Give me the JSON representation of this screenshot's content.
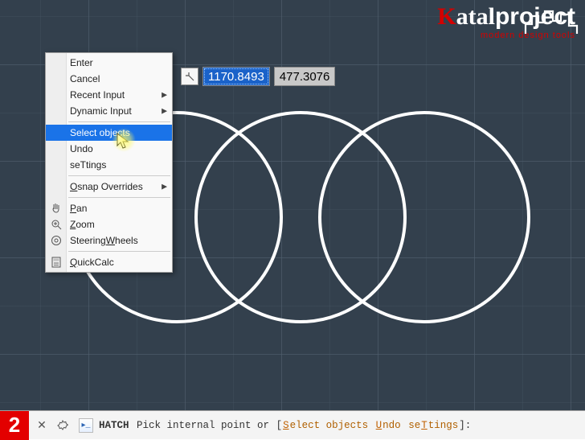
{
  "logo": {
    "text_head": "Katal",
    "text_tail": "project",
    "tagline": "modern design tools"
  },
  "coord": {
    "x": "1170.8493",
    "y": "477.3076"
  },
  "menu": {
    "enter": "Enter",
    "cancel": "Cancel",
    "recent_input": "Recent Input",
    "dynamic_input": "Dynamic Input",
    "select_objects": "Select objects",
    "undo": "Undo",
    "settings": "seTtings",
    "osnap_overrides": "Osnap Overrides",
    "pan": "Pan",
    "zoom": "Zoom",
    "steeringwheels": "SteeringWheels",
    "quickcalc": "QuickCalc"
  },
  "step": "2",
  "command": {
    "name": "HATCH",
    "prompt": "Pick internal point or",
    "opt_select_pre": "S",
    "opt_select": "elect objects",
    "opt_undo_pre": "U",
    "opt_undo": "ndo",
    "opt_settings_pre": "se",
    "opt_settings_mid": "T",
    "opt_settings_post": "tings"
  }
}
